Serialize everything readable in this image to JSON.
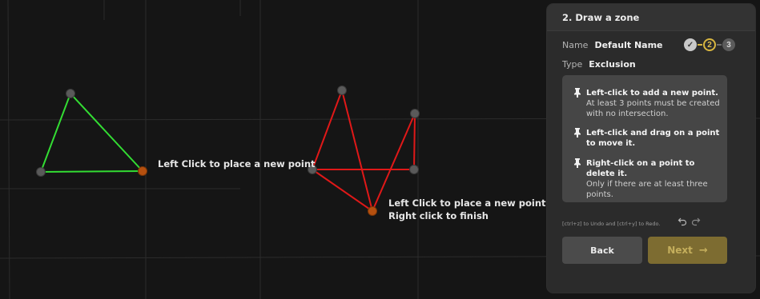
{
  "canvas": {
    "left_label": "Left Click to place a new point",
    "right_label_line1": "Left Click to place a new point",
    "right_label_line2": "Right click to finish"
  },
  "panel": {
    "title": "2. Draw a zone",
    "name_label": "Name",
    "name_value": "Default Name",
    "type_label": "Type",
    "type_value": "Exclusion",
    "steps": {
      "done_glyph": "✓",
      "current": "2",
      "next": "3"
    },
    "instructions": [
      {
        "title": "Left-click to add a new point.",
        "detail": "At least 3 points must be created with no intersection."
      },
      {
        "title": "Left-click and drag on a point to move it.",
        "detail": ""
      },
      {
        "title": "Right-click on a point to delete it.",
        "detail": "Only if there are at least three points."
      }
    ],
    "undo_hint": "[ctrl+z] to Undo and [ctrl+y] to Redo.",
    "back_label": "Back",
    "next_label": "Next",
    "next_arrow": "→"
  },
  "colors": {
    "background": "#151515",
    "valid_polygon": "#33dd33",
    "invalid_polygon": "#e01818",
    "vertex": "#5a5a5a",
    "active_vertex": "#b5500f",
    "accent": "#d8b640"
  }
}
